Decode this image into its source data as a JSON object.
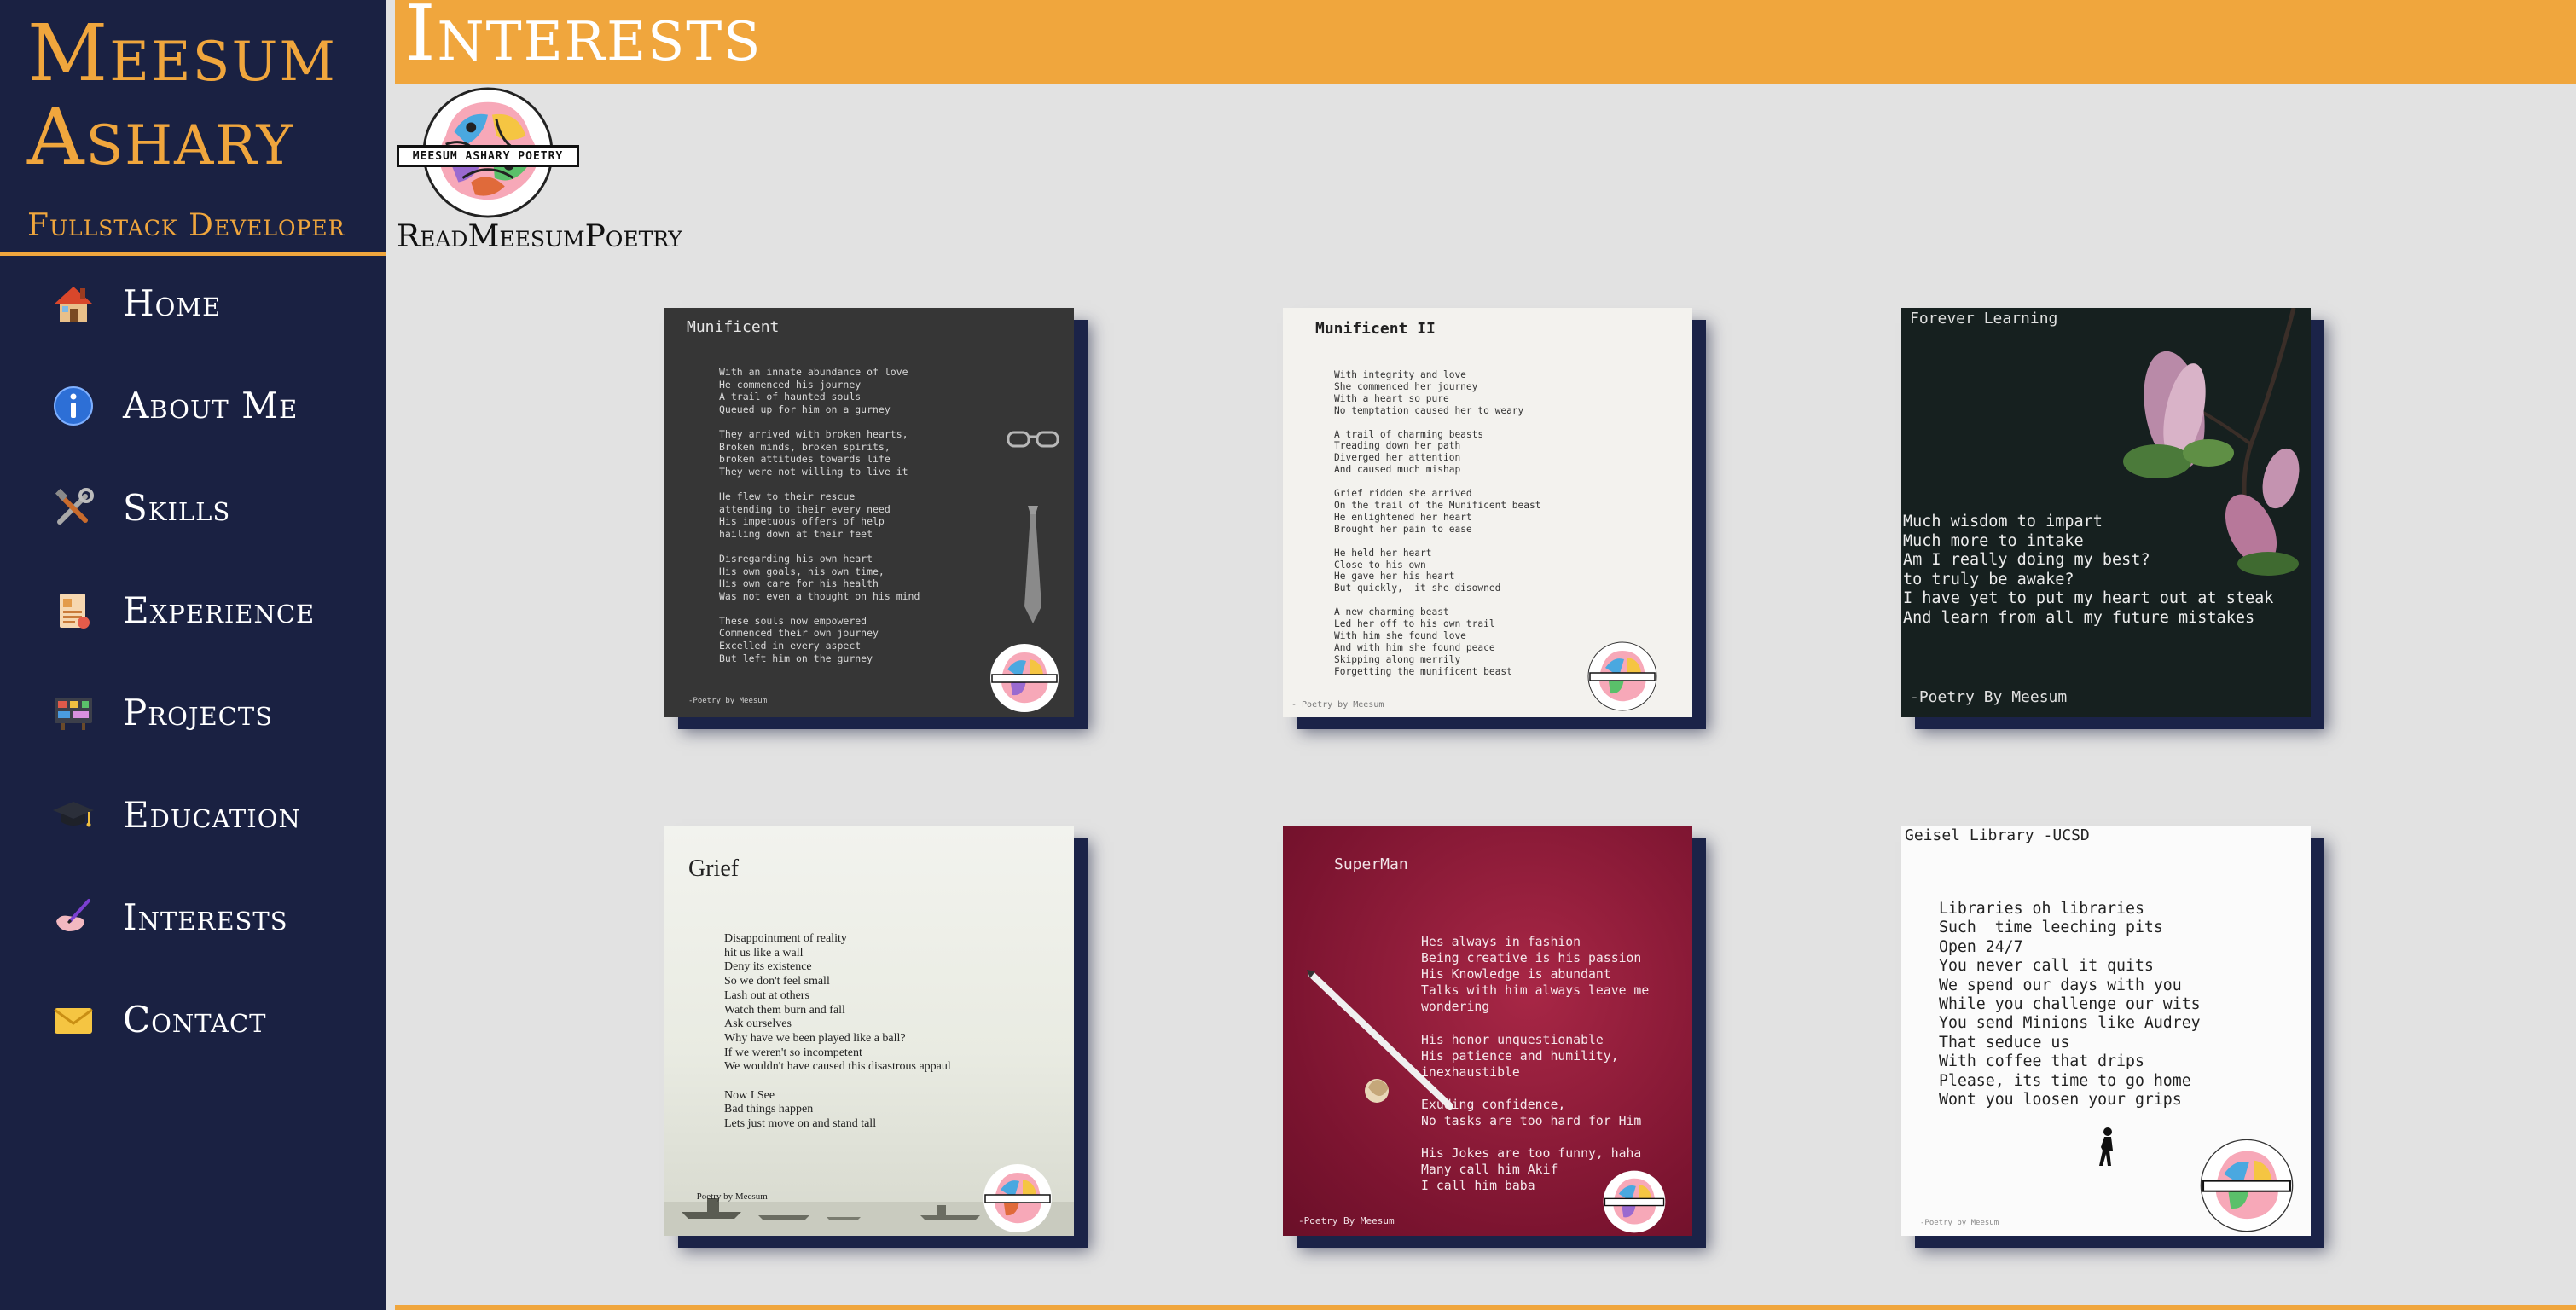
{
  "sidebar": {
    "name": "Meesum Ashary",
    "subtitle": "Fullstack Developer",
    "nav": [
      {
        "label": "Home",
        "icon": "house-icon"
      },
      {
        "label": "About Me",
        "icon": "info-icon"
      },
      {
        "label": "Skills",
        "icon": "tools-icon"
      },
      {
        "label": "Experience",
        "icon": "document-icon"
      },
      {
        "label": "Projects",
        "icon": "board-icon"
      },
      {
        "label": "Education",
        "icon": "graduation-cap-icon"
      },
      {
        "label": "Interests",
        "icon": "hand-writing-icon"
      },
      {
        "label": "Contact",
        "icon": "envelope-icon"
      }
    ]
  },
  "header": {
    "title": "Interests"
  },
  "logo": {
    "badge_text": "MEESUM ASHARY POETRY",
    "caption": "ReadMeesumPoetry"
  },
  "colors": {
    "sidebar": "#1a2142",
    "accent": "#f0a63d",
    "background": "#e2e2e2"
  },
  "poems": [
    {
      "title": "Munificent",
      "body": "With an innate abundance of love\nHe commenced his journey\nA trail of haunted souls\nQueued up for him on a gurney\n\nThey arrived with broken hearts,\nBroken minds, broken spirits,\nbroken attitudes towards life\nThey were not willing to live it\n\nHe flew to their rescue\nattending to their every need\nHis impetuous offers of help\nhailing down at their feet\n\nDisregarding his own heart\nHis own goals, his own time,\nHis own care for his health\nWas not even a thought on his mind\n\nThese souls now empowered\nCommenced their own journey\nExcelled in every aspect\nBut left him on the gurney",
      "signature": "-Poetry by Meesum"
    },
    {
      "title": "Munificent II",
      "body": "With integrity and love\nShe commenced her journey\nWith a heart so pure\nNo temptation caused her to weary\n\nA trail of charming beasts\nTreading down her path\nDiverged her attention\nAnd caused much mishap\n\nGrief ridden she arrived\nOn the trail of the Munificent beast\nHe enlightened her heart\nBrought her pain to ease\n\nHe held her heart\nClose to his own\nHe gave her his heart\nBut quickly,  it she disowned\n\nA new charming beast\nLed her off to his own trail\nWith him she found love\nAnd with him she found peace\nSkipping along merrily\nForgetting the munificent beast",
      "signature": "- Poetry by Meesum"
    },
    {
      "title": "Forever Learning",
      "body": "Much wisdom to impart\nMuch more to intake\nAm I really doing my best?\nto truly be awake?\nI have yet to put my heart out at steak\nAnd learn from all my future mistakes",
      "signature": "-Poetry By Meesum"
    },
    {
      "title": "Grief",
      "body": "Disappointment of reality\nhit us like a wall\nDeny its existence\nSo we don't feel small\nLash out at others\nWatch them burn and fall\nAsk ourselves\nWhy have we been played like a ball?\nIf we weren't so incompetent\nWe wouldn't have caused this disastrous appaul\n\nNow I See\nBad things happen\nLets just move on and stand tall",
      "signature": "-Poetry by Meesum"
    },
    {
      "title": "SuperMan",
      "body": "Hes always in fashion\nBeing creative is his passion\nHis Knowledge is abundant\nTalks with him always leave me\nwondering\n\nHis honor unquestionable\nHis patience and humility,\ninexhaustible\n\nExuding confidence,\nNo tasks are too hard for Him\n\nHis Jokes are too funny, haha\nMany call him Akif\nI call him baba",
      "signature": "-Poetry By Meesum"
    },
    {
      "title": "Geisel Library -UCSD",
      "body": "Libraries oh libraries\nSuch  time leeching pits\nOpen 24/7\nYou never call it quits\nWe spend our days with you\nWhile you challenge our wits\nYou send Minions like Audrey\nThat seduce us\nWith coffee that drips\nPlease, its time to go home\nWont you loosen your grips",
      "signature": "-Poetry by Meesum"
    }
  ]
}
